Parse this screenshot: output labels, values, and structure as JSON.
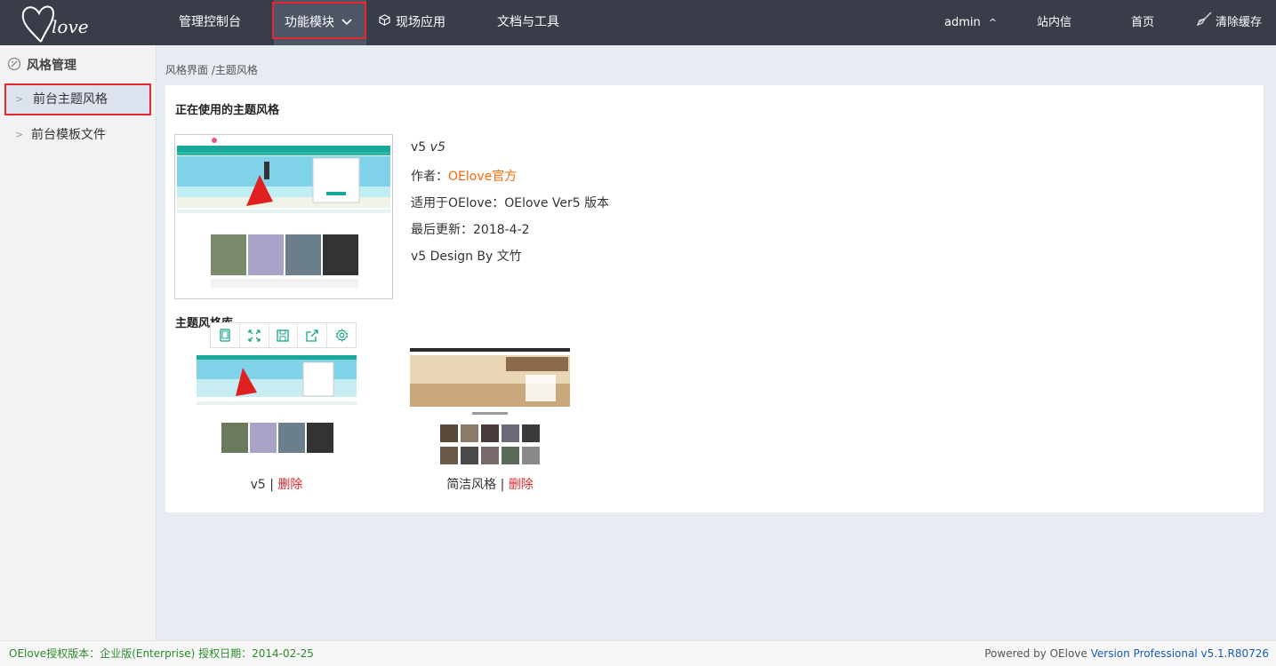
{
  "logo_text": "Oelove",
  "nav": {
    "dashboard": "管理控制台",
    "modules": "功能模块",
    "onsite": "现场应用",
    "docs": "文档与工具",
    "user": "admin",
    "messages": "站内信",
    "home": "首页",
    "clear_cache": "清除缓存"
  },
  "sidebar": {
    "heading": "风格管理",
    "items": [
      {
        "label": "前台主题风格",
        "active": true
      },
      {
        "label": "前台模板文件",
        "active": false
      }
    ]
  },
  "breadcrumb": "风格界面 /主题风格",
  "current": {
    "section_title": "正在使用的主题风格",
    "name": "v5",
    "name_italic": "v5",
    "author_label": "作者：",
    "author": "OElove官方",
    "compat": "适用于OElove：OElove Ver5 版本",
    "updated": "最后更新：2018-4-2",
    "credit": "v5 Design By 文竹"
  },
  "library": {
    "section_title": "主题风格库",
    "themes": [
      {
        "name": "v5",
        "sep": " | ",
        "delete_label": "删除"
      },
      {
        "name": "简洁风格",
        "sep": " | ",
        "delete_label": "删除"
      }
    ],
    "toolbar": [
      "tablet-icon",
      "expand-icon",
      "save-icon",
      "share-icon",
      "gear-icon"
    ]
  },
  "footer": {
    "license": "OElove授权版本：企业版(Enterprise) 授权日期：2014-02-25",
    "powered": "Powered by OElove ",
    "version": "Version Professional v5.1.R80726"
  },
  "colors": {
    "topbar": "#393d49",
    "accent_red": "#e5282b",
    "author_orange": "#ff6600",
    "footer_green": "#2b8a2b",
    "version_blue": "#1a5bb5",
    "theme_teal": "#19a89a"
  }
}
